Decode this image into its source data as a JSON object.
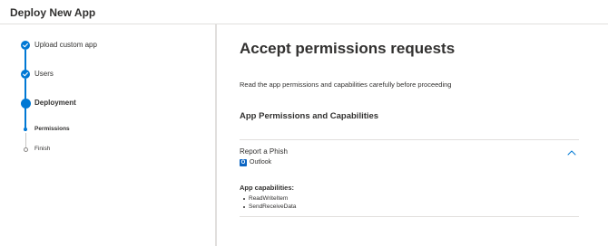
{
  "header": {
    "title": "Deploy New App"
  },
  "steps": [
    {
      "label": "Upload custom app",
      "state": "completed"
    },
    {
      "label": "Users",
      "state": "completed"
    },
    {
      "label": "Deployment",
      "state": "current"
    }
  ],
  "substeps": [
    {
      "label": "Permissions",
      "state": "current"
    },
    {
      "label": "Finish",
      "state": "pending"
    }
  ],
  "main": {
    "title": "Accept permissions requests",
    "subtitle": "Read the app permissions and capabilities carefully before proceeding",
    "section_title": "App Permissions and Capabilities",
    "app": {
      "name": "Report a Phish",
      "host": "Outlook",
      "host_icon": "outlook-icon",
      "expanded": true
    },
    "capabilities_title": "App capabilities:",
    "capabilities": [
      "ReadWriteItem",
      "SendReceiveData"
    ]
  },
  "colors": {
    "accent": "#0078d4",
    "text": "#323130",
    "divider": "#e1dfdd"
  }
}
